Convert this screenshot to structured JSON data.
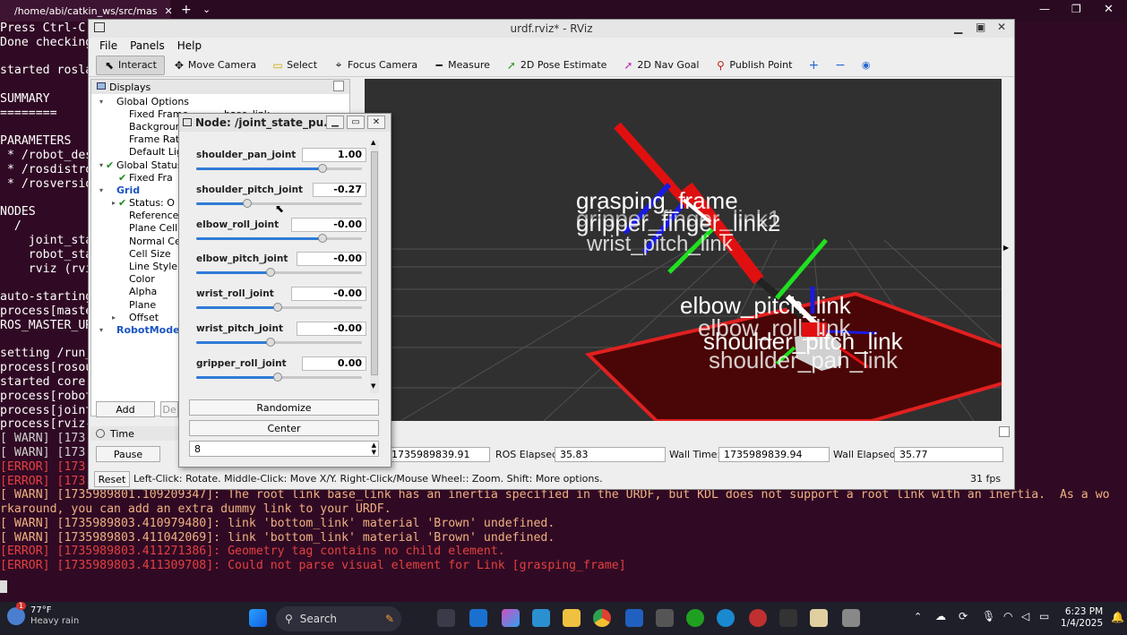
{
  "browser_tab": {
    "title": "/home/abi/catkin_ws/src/mas"
  },
  "terminal": {
    "lines": [
      {
        "t": "Press Ctrl-C",
        "c": ""
      },
      {
        "t": "Done checking",
        "c": ""
      },
      {
        "t": "",
        "c": ""
      },
      {
        "t": "started rosla",
        "c": ""
      },
      {
        "t": "",
        "c": ""
      },
      {
        "t": "SUMMARY",
        "c": ""
      },
      {
        "t": "========",
        "c": ""
      },
      {
        "t": "",
        "c": ""
      },
      {
        "t": "PARAMETERS",
        "c": ""
      },
      {
        "t": " * /robot_des",
        "c": ""
      },
      {
        "t": " * /rosdistro",
        "c": ""
      },
      {
        "t": " * /rosversio",
        "c": ""
      },
      {
        "t": "",
        "c": ""
      },
      {
        "t": "NODES",
        "c": ""
      },
      {
        "t": "  /",
        "c": ""
      },
      {
        "t": "    joint_sta",
        "c": ""
      },
      {
        "t": "    robot_sta",
        "c": ""
      },
      {
        "t": "    rviz (rvi",
        "c": ""
      },
      {
        "t": "",
        "c": ""
      },
      {
        "t": "auto-starting",
        "c": ""
      },
      {
        "t": "process[maste",
        "c": ""
      },
      {
        "t": "ROS_MASTER_UR",
        "c": ""
      },
      {
        "t": "",
        "c": ""
      },
      {
        "t": "setting /run_",
        "c": ""
      },
      {
        "t": "process[rosou",
        "c": ""
      },
      {
        "t": "started core",
        "c": ""
      },
      {
        "t": "process[robot",
        "c": ""
      },
      {
        "t": "process[joint",
        "c": ""
      },
      {
        "t": "process[rviz-",
        "c": ""
      },
      {
        "t": "[ WARN] [173",
        "c": "w"
      },
      {
        "t": "[ WARN] [173",
        "c": "w"
      },
      {
        "t": "[ERROR] [173",
        "c": "e"
      },
      {
        "t": "[ERROR] [173",
        "c": "e"
      },
      {
        "t": "[ WARN] [1735989801.109209347]: The root link base_link has an inertia specified in the URDF, but KDL does not support a root link with an inertia.  As a wo",
        "c": "y"
      },
      {
        "t": "rkaround, you can add an extra dummy link to your URDF.",
        "c": "y"
      },
      {
        "t": "[ WARN] [1735989803.410979480]: link 'bottom_link' material 'Brown' undefined.",
        "c": "y"
      },
      {
        "t": "[ WARN] [1735989803.411042069]: link 'bottom_link' material 'Brown' undefined.",
        "c": "y"
      },
      {
        "t": "[ERROR] [1735989803.411271386]: Geometry tag contains no child element.",
        "c": "e"
      },
      {
        "t": "[ERROR] [1735989803.411309708]: Could not parse visual element for Link [grasping_frame]",
        "c": "e"
      }
    ]
  },
  "rviz": {
    "title": "urdf.rviz* - RViz",
    "menu": [
      "File",
      "Panels",
      "Help"
    ],
    "tools": [
      {
        "label": "Interact",
        "icon": "cursor-icon"
      },
      {
        "label": "Move Camera",
        "icon": "move-icon"
      },
      {
        "label": "Select",
        "icon": "select-icon"
      },
      {
        "label": "Focus Camera",
        "icon": "focus-icon"
      },
      {
        "label": "Measure",
        "icon": "ruler-icon"
      },
      {
        "label": "2D Pose Estimate",
        "icon": "arrow-green-icon"
      },
      {
        "label": "2D Nav Goal",
        "icon": "arrow-pink-icon"
      },
      {
        "label": "Publish Point",
        "icon": "pin-icon"
      }
    ],
    "displays_title": "Displays",
    "tree": [
      {
        "label": "Global Options",
        "indent": 0,
        "arrow": "▾",
        "chk": "",
        "blue": false,
        "value": ""
      },
      {
        "label": "Fixed Frame",
        "indent": 1,
        "arrow": "",
        "chk": "",
        "blue": false,
        "value": "base_link"
      },
      {
        "label": "Background",
        "indent": 1,
        "arrow": "",
        "chk": "",
        "blue": false,
        "value": ""
      },
      {
        "label": "Frame Rate",
        "indent": 1,
        "arrow": "",
        "chk": "",
        "blue": false,
        "value": ""
      },
      {
        "label": "Default Light",
        "indent": 1,
        "arrow": "",
        "chk": "",
        "blue": false,
        "value": ""
      },
      {
        "label": "Global Status",
        "indent": 0,
        "arrow": "▾",
        "chk": "✔",
        "blue": false,
        "value": ""
      },
      {
        "label": "Fixed Fra",
        "indent": 1,
        "arrow": "",
        "chk": "✔",
        "blue": false,
        "value": ""
      },
      {
        "label": "Grid",
        "indent": 0,
        "arrow": "▾",
        "chk": "",
        "blue": true,
        "value": ""
      },
      {
        "label": "Status: O",
        "indent": 1,
        "arrow": "▸",
        "chk": "✔",
        "blue": false,
        "value": ""
      },
      {
        "label": "Reference Fr",
        "indent": 1,
        "arrow": "",
        "chk": "",
        "blue": false,
        "value": ""
      },
      {
        "label": "Plane Cell Co",
        "indent": 1,
        "arrow": "",
        "chk": "",
        "blue": false,
        "value": ""
      },
      {
        "label": "Normal Cell C",
        "indent": 1,
        "arrow": "",
        "chk": "",
        "blue": false,
        "value": ""
      },
      {
        "label": "Cell Size",
        "indent": 1,
        "arrow": "",
        "chk": "",
        "blue": false,
        "value": ""
      },
      {
        "label": "Line Style",
        "indent": 1,
        "arrow": "",
        "chk": "",
        "blue": false,
        "value": ""
      },
      {
        "label": "Color",
        "indent": 1,
        "arrow": "",
        "chk": "",
        "blue": false,
        "value": ""
      },
      {
        "label": "Alpha",
        "indent": 1,
        "arrow": "",
        "chk": "",
        "blue": false,
        "value": ""
      },
      {
        "label": "Plane",
        "indent": 1,
        "arrow": "",
        "chk": "",
        "blue": false,
        "value": ""
      },
      {
        "label": "Offset",
        "indent": 1,
        "arrow": "▸",
        "chk": "",
        "blue": false,
        "value": ""
      },
      {
        "label": "RobotMode",
        "indent": 0,
        "arrow": "▾",
        "chk": "",
        "blue": true,
        "value": ""
      }
    ],
    "add_label": "Add",
    "remove_label": "De",
    "time_title": "Time",
    "pause_label": "Pause",
    "reset_label": "Reset",
    "ros_time_value": "1735989839.91",
    "ros_elapsed_label": "ROS Elapsed:",
    "ros_elapsed_value": "35.83",
    "wall_time_label": "Wall Time:",
    "wall_time_value": "1735989839.94",
    "wall_elapsed_label": "Wall Elapsed:",
    "wall_elapsed_value": "35.77",
    "hint": "Left-Click: Rotate. Middle-Click: Move X/Y. Right-Click/Mouse Wheel:: Zoom. Shift: More options.",
    "fps": "31 fps",
    "frame_labels": [
      "grasping_frame",
      "gripper_finger_link2",
      "gripper_finger_link1",
      "wrist_pitch_link",
      "elbow_pitch_link",
      "elbow_roll_link",
      "shoulder_pitch_link",
      "shoulder_pan_link"
    ]
  },
  "joint_window": {
    "title": "Node: /joint_state_pu...",
    "joints": [
      {
        "name": "shoulder_pan_joint",
        "value": "1.00",
        "fraction": 0.76
      },
      {
        "name": "shoulder_pitch_joint",
        "value": "-0.27",
        "fraction": 0.31
      },
      {
        "name": "elbow_roll_joint",
        "value": "-0.00",
        "fraction": 0.76
      },
      {
        "name": "elbow_pitch_joint",
        "value": "-0.00",
        "fraction": 0.45
      },
      {
        "name": "wrist_roll_joint",
        "value": "-0.00",
        "fraction": 0.49
      },
      {
        "name": "wrist_pitch_joint",
        "value": "-0.00",
        "fraction": 0.45
      },
      {
        "name": "gripper_roll_joint",
        "value": "0.00",
        "fraction": 0.49
      }
    ],
    "randomize_label": "Randomize",
    "center_label": "Center",
    "spin_value": "8"
  },
  "taskbar": {
    "temp": "77°F",
    "weather": "Heavy rain",
    "search": "Search",
    "time": "6:23 PM",
    "date": "1/4/2025",
    "notification_count": "1"
  }
}
